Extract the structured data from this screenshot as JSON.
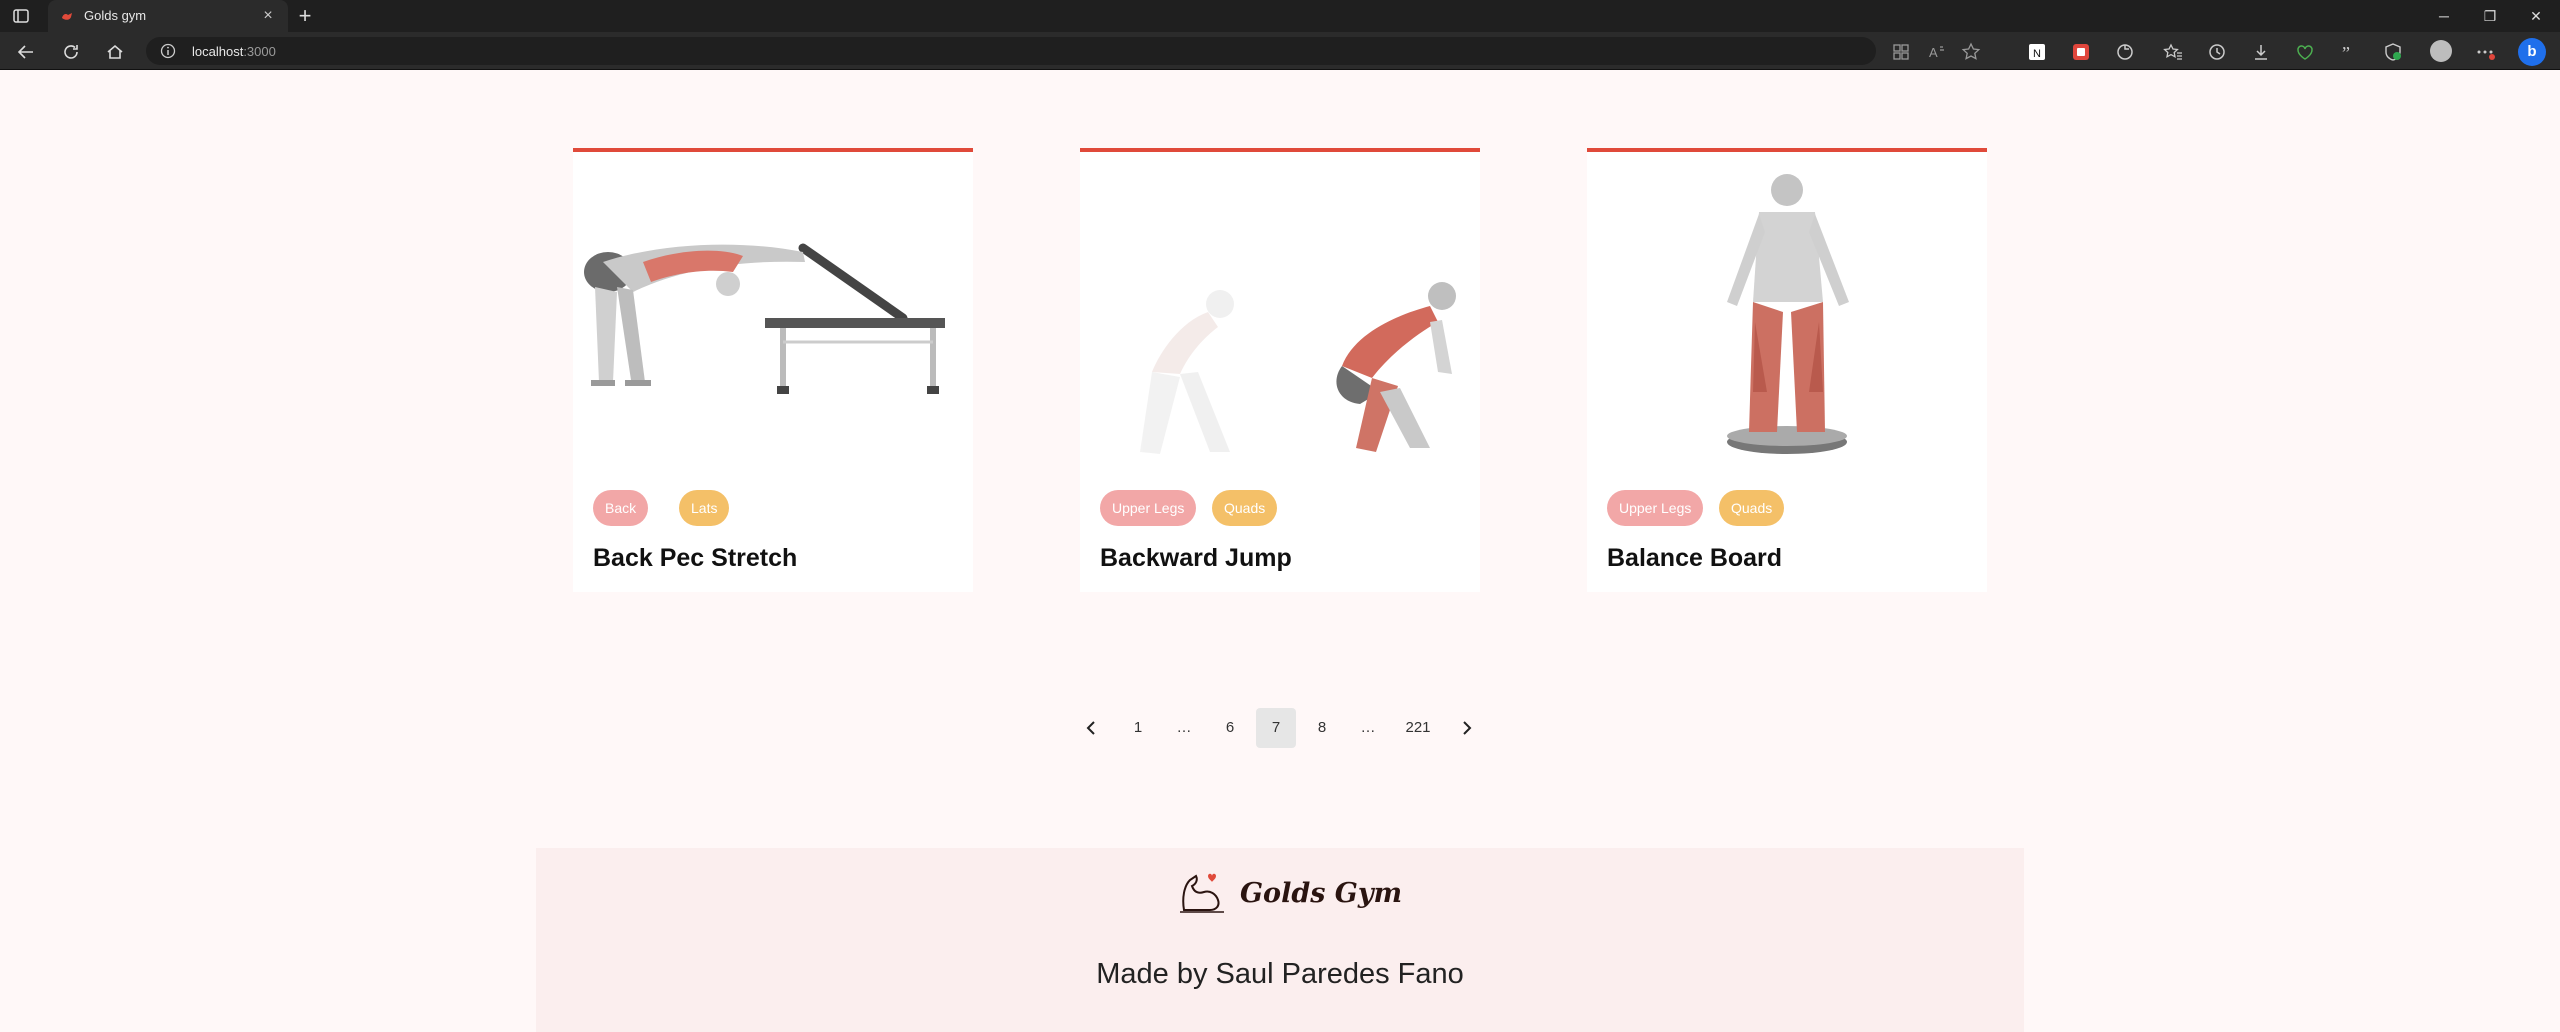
{
  "browser": {
    "tab_title": "Golds gym",
    "url_host": "localhost",
    "url_port": ":3000"
  },
  "exercises": [
    {
      "name": "Back Pec Stretch",
      "body_part": "Back",
      "target": "Lats"
    },
    {
      "name": "Backward Jump",
      "body_part": "Upper Legs",
      "target": "Quads"
    },
    {
      "name": "Balance Board",
      "body_part": "Upper Legs",
      "target": "Quads"
    }
  ],
  "pagination": {
    "pages": [
      "1",
      "…",
      "6",
      "7",
      "8",
      "…",
      "221"
    ],
    "current": "7"
  },
  "footer": {
    "brand": "Golds Gym",
    "credit": "Made by Saul Paredes Fano"
  },
  "colors": {
    "accent": "#e04a3a",
    "body_part_tag": "#f2a7a7",
    "target_tag": "#f4c068",
    "page_bg": "#fff8f8",
    "footer_bg": "#fbeeee"
  }
}
